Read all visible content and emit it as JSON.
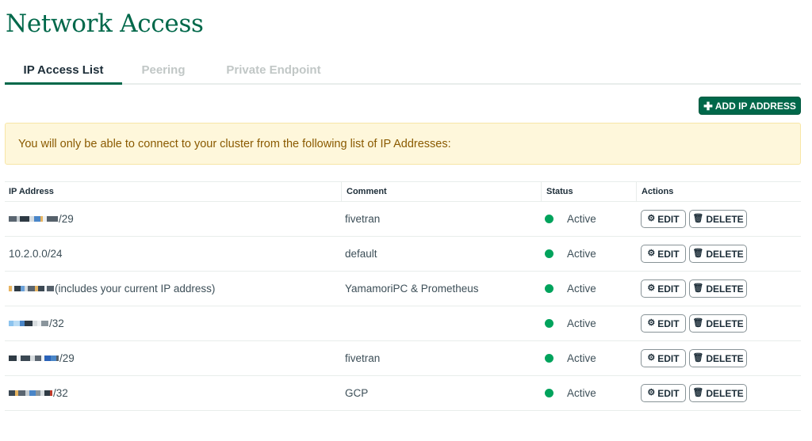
{
  "page": {
    "title": "Network Access"
  },
  "tabs": [
    {
      "label": "IP Access List",
      "active": true
    },
    {
      "label": "Peering",
      "active": false
    },
    {
      "label": "Private Endpoint",
      "active": false
    }
  ],
  "toolbar": {
    "add_label": "ADD IP ADDRESS"
  },
  "banner": {
    "text": "You will only be able to connect to your cluster from the following list of IP Addresses:"
  },
  "table": {
    "headers": [
      "IP Address",
      "Comment",
      "Status",
      "Actions"
    ],
    "edit_label": "EDIT",
    "delete_label": "DELETE",
    "rows": [
      {
        "ip_suffix": "/29",
        "comment": "fivetran",
        "status": "Active"
      },
      {
        "ip_suffix": "10.2.0.0/24",
        "comment": "default",
        "status": "Active"
      },
      {
        "ip_suffix": " (includes your current IP address)",
        "comment": "YamamoriPC & Prometheus",
        "status": "Active"
      },
      {
        "ip_suffix": "/32",
        "comment": "",
        "status": "Active"
      },
      {
        "ip_suffix": "/29",
        "comment": "fivetran",
        "status": "Active"
      },
      {
        "ip_suffix": "/32",
        "comment": "GCP",
        "status": "Active"
      }
    ]
  },
  "colors": {
    "brand": "#00684a",
    "status_active": "#00a35c",
    "banner_bg": "#fef7db"
  }
}
